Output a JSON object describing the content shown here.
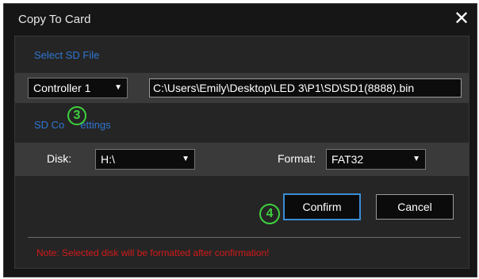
{
  "dialog": {
    "title": "Copy To Card",
    "close_glyph": "✕"
  },
  "select_sd": {
    "section_label": "Select SD File",
    "controller": "Controller 1",
    "path": "C:\\Users\\Emily\\Desktop\\LED 3\\P1\\SD\\SD1(8888).bin"
  },
  "copy_settings": {
    "section_label_start": "SD Co",
    "section_label_end": "ettings",
    "disk_label": "Disk:",
    "disk_value": "H:\\",
    "format_label": "Format:",
    "format_value": "FAT32"
  },
  "buttons": {
    "confirm": "Confirm",
    "cancel": "Cancel"
  },
  "note": "Note: Selected disk will be formatted after confirmation!",
  "markers": {
    "step3": "3",
    "step4": "4"
  },
  "colors": {
    "background": "#161616",
    "panel": "#252525",
    "band": "#3a3a3a",
    "section_label": "#2f76d1",
    "confirm_border": "#3b8dd6",
    "note": "#d21a1a",
    "marker": "#3fd13f"
  },
  "icons": {
    "dropdown": "chevron-down-icon",
    "close": "close-icon"
  }
}
